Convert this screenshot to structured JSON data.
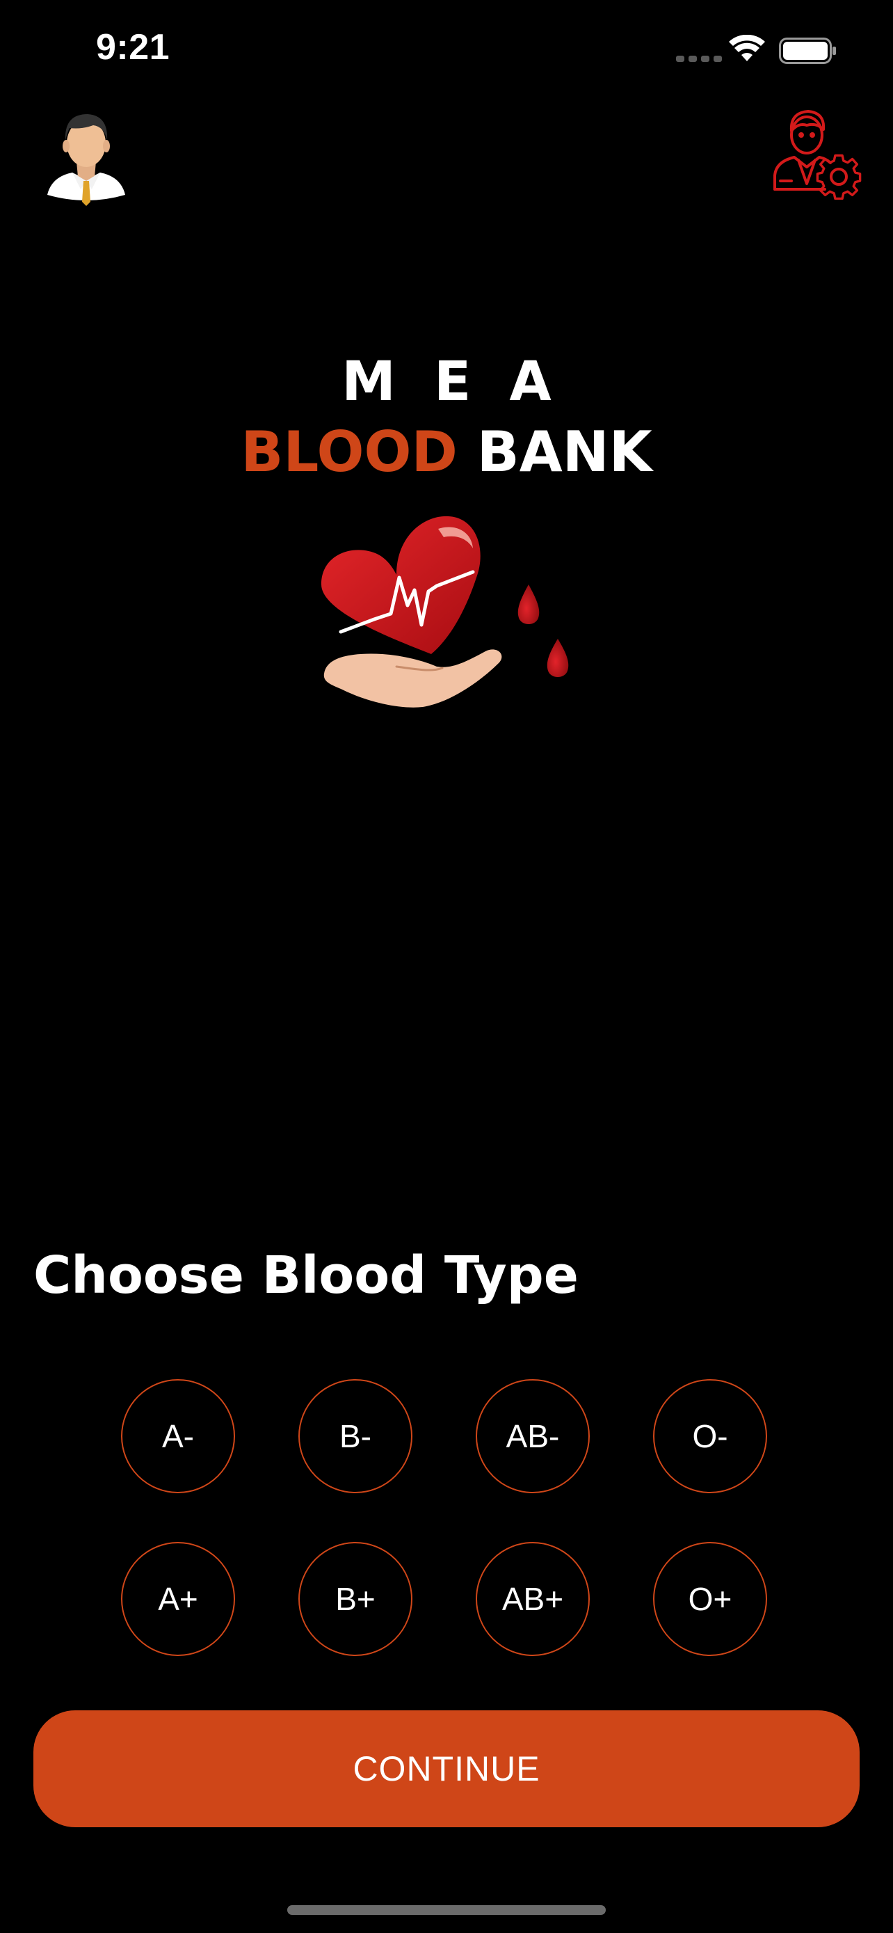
{
  "status_bar": {
    "time": "9:21"
  },
  "header": {
    "profile_icon": "user-avatar-icon",
    "settings_icon": "admin-settings-icon"
  },
  "branding": {
    "title_line1": "M E A",
    "title_blood": "BLOOD",
    "title_bank": "BANK",
    "logo_icon": "heart-in-hand-logo"
  },
  "blood_type_section": {
    "title": "Choose Blood Type",
    "options": [
      "A-",
      "B-",
      "AB-",
      "O-",
      "A+",
      "B+",
      "AB+",
      "O+"
    ]
  },
  "continue_button": {
    "label": "CONTINUE"
  },
  "colors": {
    "accent": "#cf4618",
    "background": "#000000",
    "text": "#ffffff",
    "settings_icon": "#d31a1a"
  }
}
